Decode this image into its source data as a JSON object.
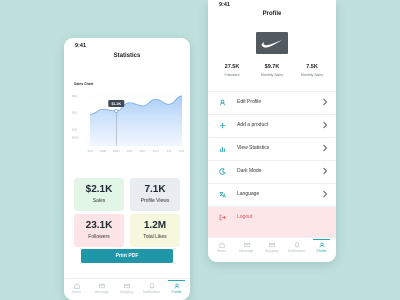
{
  "statistics_screen": {
    "time": "9:41",
    "title": "Statistics",
    "chart_label": "Sales Chart",
    "cards": [
      {
        "value": "$2.1K",
        "label": "Sales",
        "color": "#e2f6e7"
      },
      {
        "value": "7.1K",
        "label": "Profile Views",
        "color": "#e9ecf0"
      },
      {
        "value": "23.1K",
        "label": "Followers",
        "color": "#fde4e7"
      },
      {
        "value": "1.2M",
        "label": "Total Likes",
        "color": "#f5f8dc"
      }
    ],
    "print_button": "Print PDF",
    "tabs": [
      {
        "label": "Home",
        "icon": "home-icon"
      },
      {
        "label": "Message",
        "icon": "message-icon"
      },
      {
        "label": "Shipping",
        "icon": "shipping-icon"
      },
      {
        "label": "Notification",
        "icon": "notification-icon"
      },
      {
        "label": "Profile",
        "icon": "profile-icon",
        "active": true
      }
    ]
  },
  "chart_data": {
    "type": "area",
    "title": "Sales Chart",
    "x": [
      "JAN",
      "FEB",
      "MAR",
      "APR",
      "MAY",
      "JUN",
      "JUL",
      "AUG"
    ],
    "yticks": [
      "$3K",
      "$2K",
      "$1K",
      "$500"
    ],
    "ylim": [
      0,
      3000
    ],
    "series": [
      {
        "values": [
          1900,
          2200,
          2100,
          2600,
          2400,
          2800,
          2500,
          3000
        ]
      }
    ],
    "annotation": {
      "label": "$1.2K",
      "x": "MAR"
    },
    "grid": true,
    "accent": "#7fb0f0"
  },
  "profile_screen": {
    "time": "9:41",
    "title": "Profile",
    "logo": "nike-logo",
    "stats": [
      {
        "value": "27.5K",
        "label": "Followers"
      },
      {
        "value": "$9.7K",
        "label": "Monthly Sales"
      },
      {
        "value": "7.5K",
        "label": "Monthly Sales"
      }
    ],
    "menu": [
      {
        "label": "Edit Profile",
        "icon": "user-icon"
      },
      {
        "label": "Add a product",
        "icon": "plus-icon"
      },
      {
        "label": "View Statistics",
        "icon": "chart-icon"
      },
      {
        "label": "Dark Mode",
        "icon": "moon-icon"
      },
      {
        "label": "Language",
        "icon": "language-icon"
      },
      {
        "label": "Logout",
        "icon": "logout-icon"
      }
    ],
    "tabs": [
      {
        "label": "Home",
        "icon": "home-icon"
      },
      {
        "label": "Message",
        "icon": "message-icon"
      },
      {
        "label": "Shipping",
        "icon": "shipping-icon"
      },
      {
        "label": "Notification",
        "icon": "notification-icon"
      },
      {
        "label": "Profile",
        "icon": "profile-icon",
        "active": true
      }
    ]
  },
  "colors": {
    "background": "#bfe0dc",
    "accent": "#2097a8",
    "logout": "#e0505f"
  }
}
